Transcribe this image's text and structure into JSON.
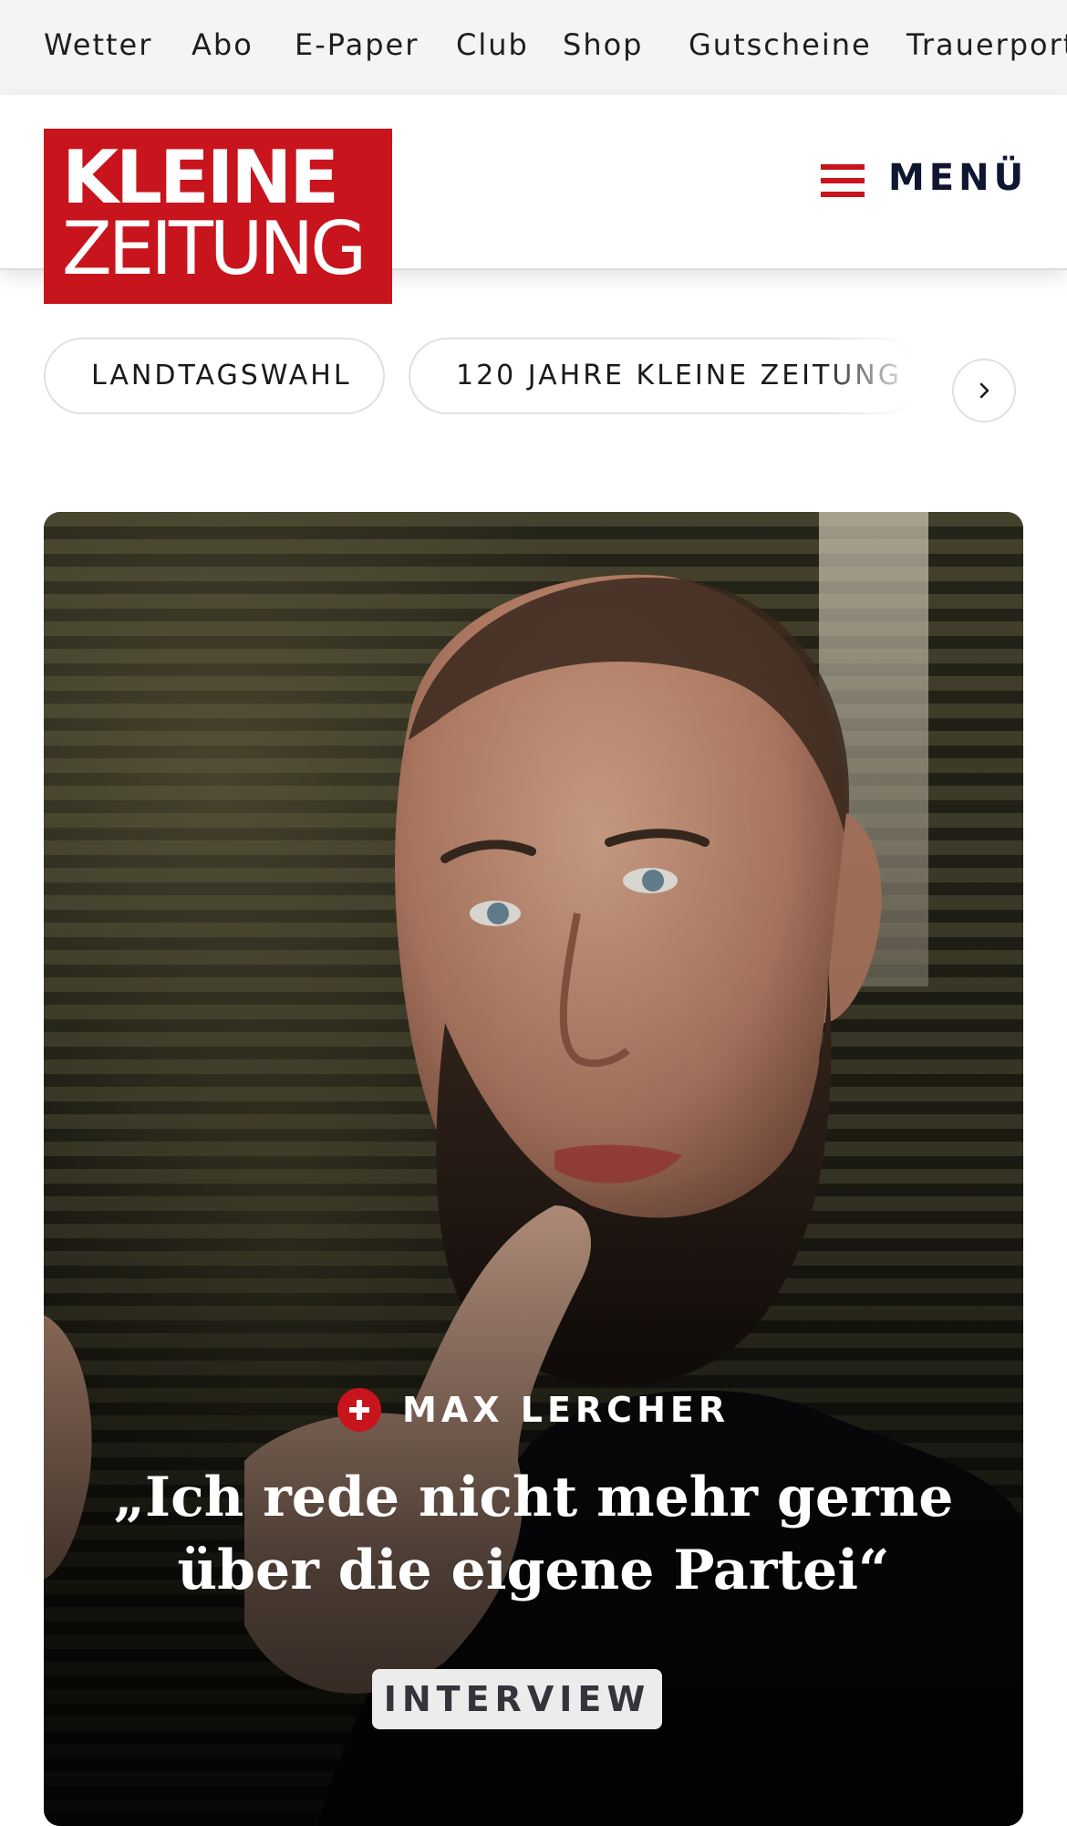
{
  "topnav": {
    "items": [
      "Wetter",
      "Abo",
      "E-Paper",
      "Club",
      "Shop",
      "Gutscheine",
      "Trauerportal"
    ]
  },
  "logo": {
    "line1": "KLEINE",
    "line2": "ZEITUNG"
  },
  "menu": {
    "label": "MENÜ"
  },
  "chips": [
    "LANDTAGSWAHL",
    "120 JAHRE KLEINE ZEITUNG"
  ],
  "hero": {
    "kicker": "MAX LERCHER",
    "headline": "„Ich rede nicht mehr gerne über die eigene Partei“",
    "tag": "INTERVIEW"
  },
  "colors": {
    "brand_red": "#c8141c",
    "menu_text": "#0e1630"
  },
  "icons": {
    "menu": "hamburger-icon",
    "premium": "plus-icon",
    "next": "chevron-right-icon"
  }
}
